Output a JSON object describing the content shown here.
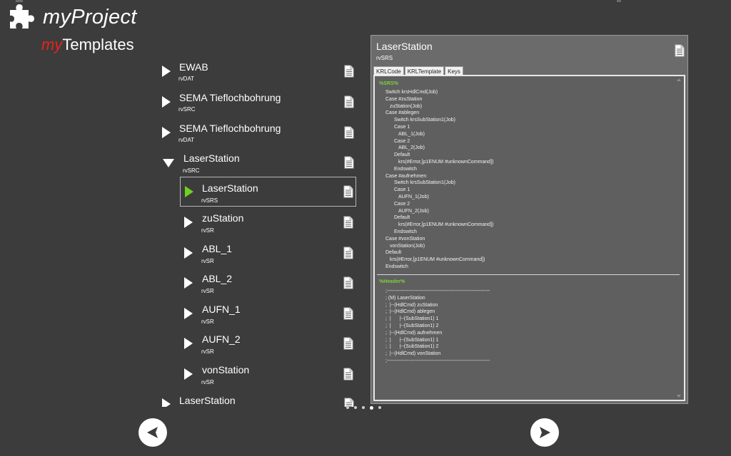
{
  "app": {
    "title": "myProject",
    "subtitle_my": "my",
    "subtitle_rest": "Templates",
    "logo_icon": "puzzle-piece-icon",
    "accent_color": "#6fd11d",
    "brand_red": "#e8221b"
  },
  "tree": {
    "items": [
      {
        "title": "EWAB",
        "sub": "rvDAT"
      },
      {
        "title": "SEMA Tieflochbohrung",
        "sub": "rvSRC"
      },
      {
        "title": "SEMA Tieflochbohrung",
        "sub": "rvDAT"
      },
      {
        "title": "LaserStation",
        "sub": "rvSRC"
      },
      {
        "title": "LaserStation",
        "sub": "rvSRS"
      },
      {
        "title": "zuStation",
        "sub": "rvSR"
      },
      {
        "title": "ABL_1",
        "sub": "rvSR"
      },
      {
        "title": "ABL_2",
        "sub": "rvSR"
      },
      {
        "title": "AUFN_1",
        "sub": "rvSR"
      },
      {
        "title": "AUFN_2",
        "sub": "rvSR"
      },
      {
        "title": "vonStation",
        "sub": "rvSR"
      },
      {
        "title": "LaserStation",
        "sub": ""
      }
    ]
  },
  "preview": {
    "title": "LaserStation",
    "sub": "rvSRS",
    "tabs": [
      "KRLCode",
      "KRLTemplate",
      "Keys"
    ],
    "section1": "%SRS%",
    "srs_lines": [
      "Switch krsHdlCmd(Job)",
      "Case #zuStation",
      "zuStation(Job)",
      "Case #ablegen",
      "Switch krsSubStation1(Job)",
      "Case 1",
      "ABL_1(Job)",
      "Case 2",
      "ABL_2(Job)",
      "Default",
      "krs(#Error,[p1ENUM #unknownCommand])",
      "Endswitch",
      "Case #aufnehmen",
      "Switch krsSubStation1(Job)",
      "Case 1",
      "AUFN_1(Job)",
      "Case 2",
      "AUFN_2(Job)",
      "Default",
      "krs(#Error,[p1ENUM #unknownCommand])",
      "Endswitch",
      "Case #vonStation",
      "vonStation(Job)",
      "Default",
      "krs(#Error,[p1ENUM #unknownCommand])",
      "Endswitch"
    ],
    "section2": "%Header%",
    "header_lines": [
      ";--------------------------------------------------------------",
      "; (M) LaserStation",
      ";  |--(HdlCmd) zuStation",
      ";  |--(HdlCmd) ablegen",
      ";  |      |--(SubStation1) 1",
      ";  |      |--(SubStation1) 2",
      ";  |--(HdlCmd) aufnehmen",
      ";  |      |--(SubStation1) 1",
      ";  |      |--(SubStation1) 2",
      ";  |--(HdlCmd) vonStation",
      ";--------------------------------------------------------------"
    ]
  },
  "pager": {
    "count": 5,
    "active": 3
  },
  "nav": {
    "prev_icon": "arrow-left-icon",
    "next_icon": "arrow-right-icon"
  }
}
